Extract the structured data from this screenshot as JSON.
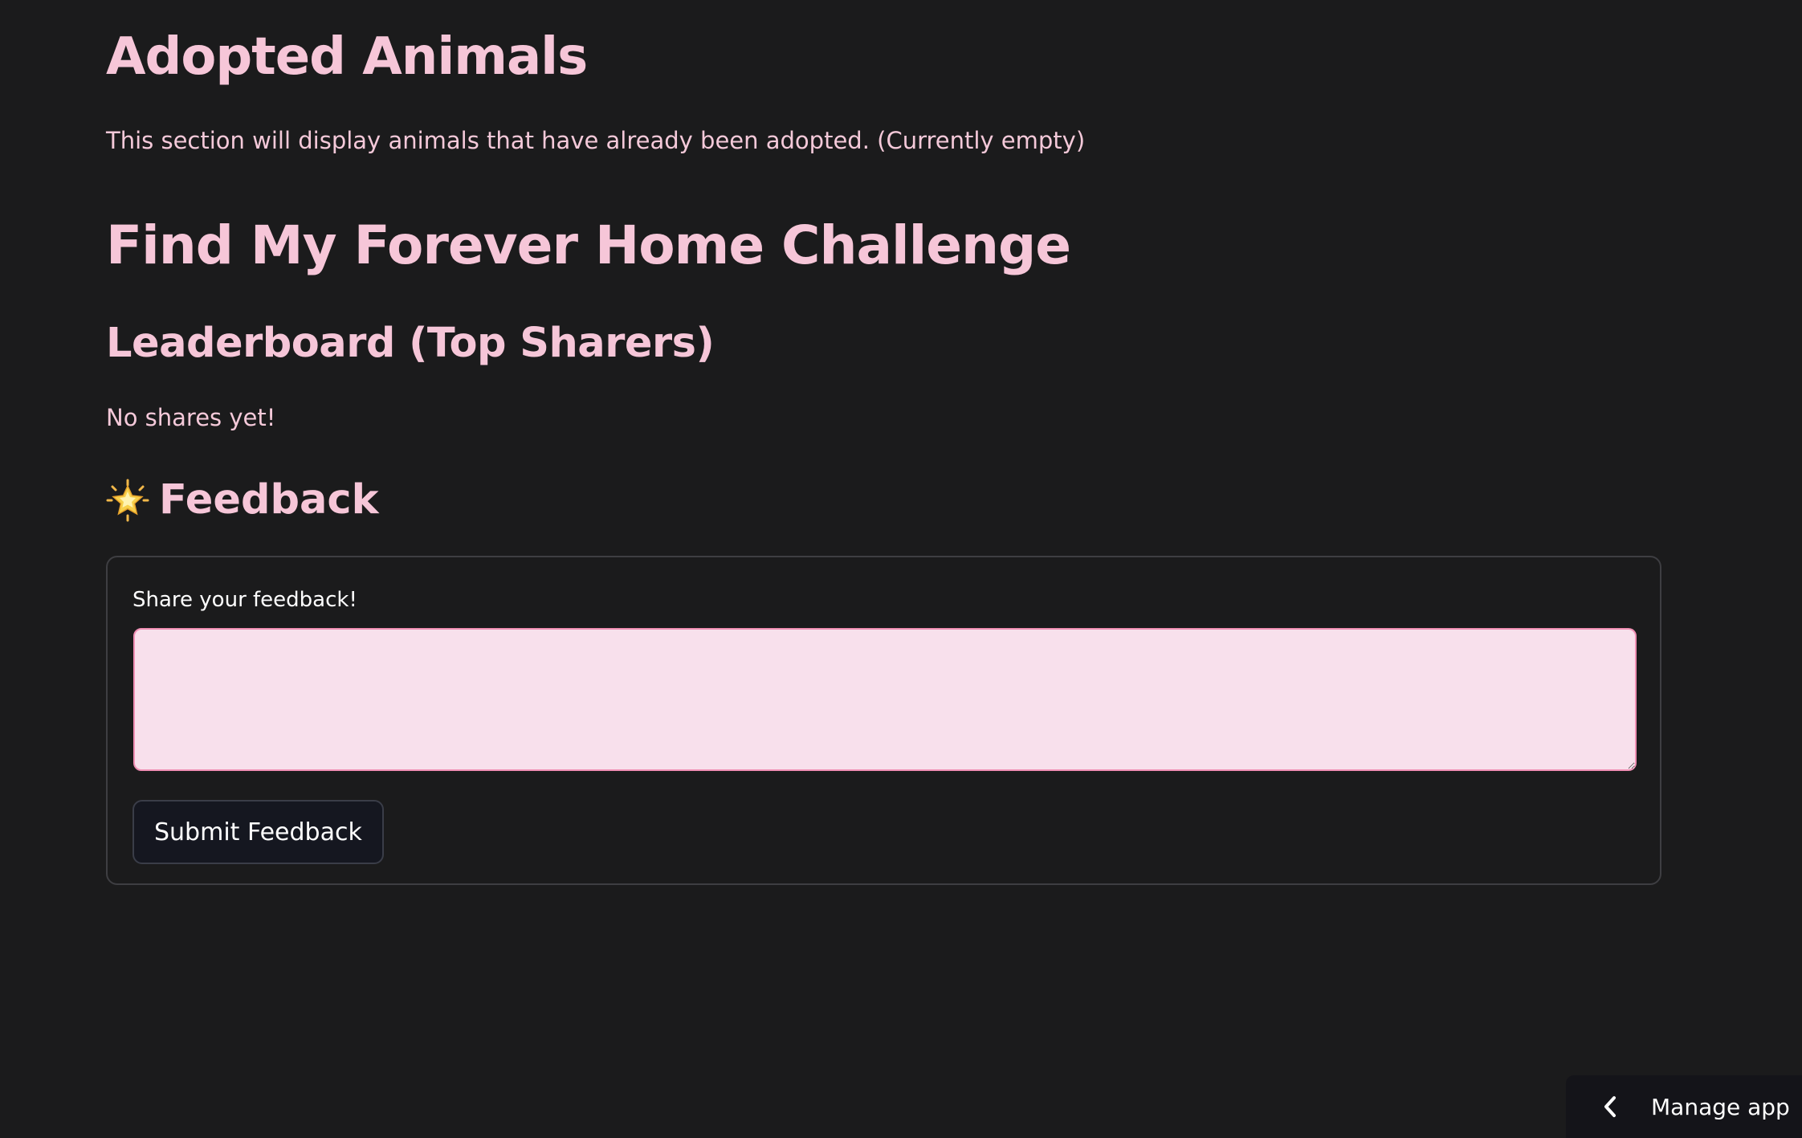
{
  "adopted": {
    "title": "Adopted Animals",
    "description": "This section will display animals that have already been adopted. (Currently empty)"
  },
  "challenge": {
    "title": "Find My Forever Home Challenge"
  },
  "leaderboard": {
    "title": "Leaderboard (Top Sharers)",
    "empty_text": "No shares yet!"
  },
  "feedback": {
    "icon": "glowing-star-icon",
    "title": "Feedback",
    "form": {
      "label": "Share your feedback!",
      "textarea_value": "",
      "submit_label": "Submit Feedback"
    }
  },
  "footer": {
    "manage_icon": "chevron-left-icon",
    "manage_label": "Manage app"
  },
  "colors": {
    "background": "#1b1b1c",
    "heading_pink": "#f6c6d8",
    "textarea_bg": "#f8e0ec",
    "textarea_border": "#f08fb4"
  }
}
